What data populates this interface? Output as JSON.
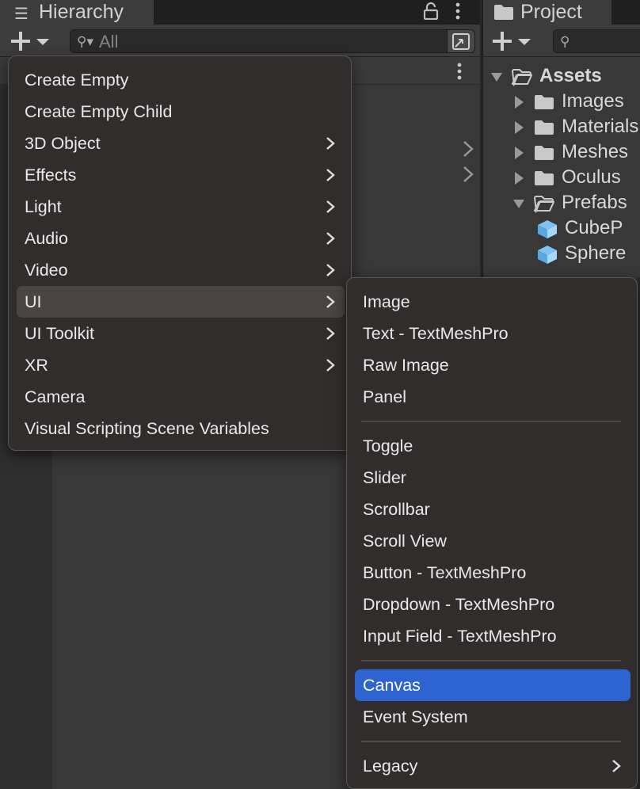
{
  "hierarchy": {
    "title": "Hierarchy",
    "search_placeholder": "All"
  },
  "project": {
    "title": "Project",
    "tree": [
      {
        "label": "Assets",
        "icon": "folder-open-icon",
        "expanded": true,
        "level": 0
      },
      {
        "label": "Images",
        "icon": "folder-icon",
        "expanded": false,
        "level": 1
      },
      {
        "label": "Materials",
        "icon": "folder-icon",
        "expanded": false,
        "level": 1
      },
      {
        "label": "Meshes",
        "icon": "folder-icon",
        "expanded": false,
        "level": 1
      },
      {
        "label": "Oculus",
        "icon": "folder-icon",
        "expanded": false,
        "level": 1
      },
      {
        "label": "Prefabs",
        "icon": "folder-open-icon",
        "expanded": true,
        "level": 1
      },
      {
        "label": "CubeP",
        "icon": "prefab-cube-icon",
        "level": 2
      },
      {
        "label": "Sphere",
        "icon": "prefab-cube-icon",
        "level": 2
      }
    ]
  },
  "context_menu": {
    "items": [
      {
        "label": "Create Empty",
        "submenu": false
      },
      {
        "label": "Create Empty Child",
        "submenu": false
      },
      {
        "label": "3D Object",
        "submenu": true
      },
      {
        "label": "Effects",
        "submenu": true
      },
      {
        "label": "Light",
        "submenu": true
      },
      {
        "label": "Audio",
        "submenu": true
      },
      {
        "label": "Video",
        "submenu": true
      },
      {
        "label": "UI",
        "submenu": true,
        "active": true
      },
      {
        "label": "UI Toolkit",
        "submenu": true
      },
      {
        "label": "XR",
        "submenu": true
      },
      {
        "label": "Camera",
        "submenu": false
      },
      {
        "label": "Visual Scripting Scene Variables",
        "submenu": false
      }
    ]
  },
  "ui_submenu": {
    "items": [
      {
        "label": "Image"
      },
      {
        "label": "Text - TextMeshPro"
      },
      {
        "label": "Raw Image"
      },
      {
        "label": "Panel"
      },
      {
        "label": "Toggle"
      },
      {
        "label": "Slider"
      },
      {
        "label": "Scrollbar"
      },
      {
        "label": "Scroll View"
      },
      {
        "label": "Button - TextMeshPro"
      },
      {
        "label": "Dropdown - TextMeshPro"
      },
      {
        "label": "Input Field - TextMeshPro"
      },
      {
        "label": "Canvas",
        "selected": true
      },
      {
        "label": "Event System"
      },
      {
        "label": "Legacy",
        "submenu": true
      }
    ]
  },
  "colors": {
    "selection": "#2d64d1",
    "menu_background": "#302d2c",
    "panel_background": "#383838",
    "prefab_icon": "#7ec3f0"
  }
}
